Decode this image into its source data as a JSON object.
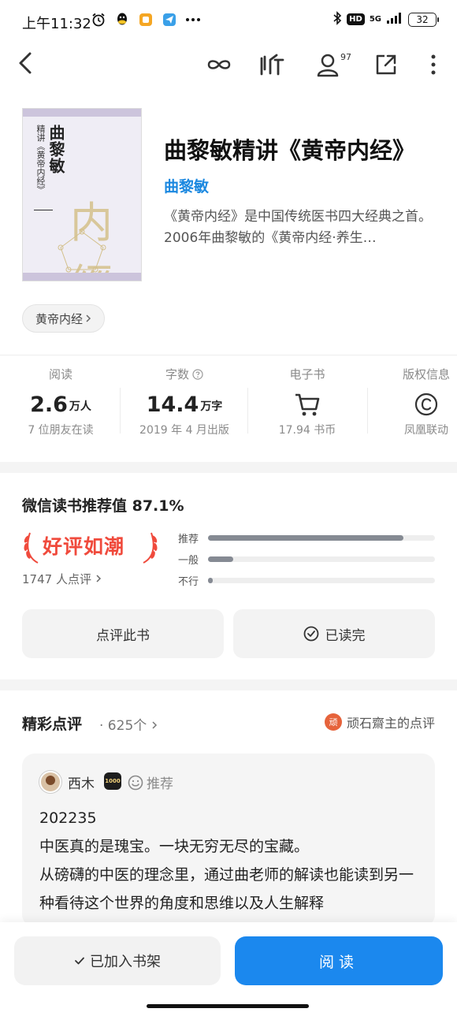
{
  "status_bar": {
    "time": "上午11:32",
    "network": "5G",
    "hd": "HD",
    "battery": "32"
  },
  "nav": {
    "listen_label": "听",
    "follow_count": "97"
  },
  "book": {
    "title": "曲黎敏精讲《黄帝内经》",
    "author": "曲黎敏",
    "intro": "《黄帝内经》是中国传统医书四大经典之首。2006年曲黎敏的《黄帝内经·养生…",
    "tag": "黄帝内经",
    "cover": {
      "title": "曲黎敏",
      "subtitle": "精讲《黄帝内经》",
      "art": "内經"
    }
  },
  "stats": [
    {
      "label": "阅读",
      "value": "2.6",
      "unit": "万人",
      "sub": "7 位朋友在读"
    },
    {
      "label": "字数",
      "value": "14.4",
      "unit": "万字",
      "sub": "2019 年 4 月出版"
    },
    {
      "label": "电子书",
      "sub": "17.94 书币"
    },
    {
      "label": "版权信息",
      "sub": "凤凰联动"
    }
  ],
  "recommendation": {
    "title": "微信读书推荐值 87.1%",
    "badge": "好评如潮",
    "count": "1747 人点评",
    "bars": [
      {
        "label": "推荐",
        "fraction": 0.86
      },
      {
        "label": "一般",
        "fraction": 0.11
      },
      {
        "label": "不行",
        "fraction": 0.02
      }
    ],
    "review_button": "点评此书",
    "read_button": "已读完"
  },
  "reviews": {
    "title": "精彩点评",
    "count": "· 625个",
    "featured": "顽石齋主的点评",
    "seal": "顽",
    "items": [
      {
        "name": "西木",
        "level": "1000",
        "tag": "推荐",
        "body": "202235\n中医真的是瑰宝。一块无穷无尽的宝藏。\n从磅礴的中医的理念里，通过曲老师的解读也能读到另一种看待这个世界的角度和思维以及人生解释"
      }
    ]
  },
  "bottom": {
    "shelf_button": "已加入书架",
    "read_button": "阅读"
  }
}
